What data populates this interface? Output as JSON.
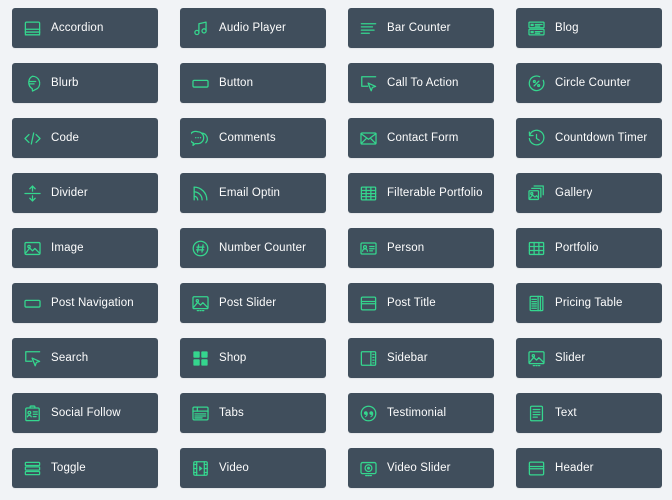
{
  "theme": {
    "background": "#f1f3f6",
    "card_background": "#404e5c",
    "icon_color": "#35d68e",
    "label_color": "#fdfdfd"
  },
  "grid": {
    "columns": 4,
    "rows": 9,
    "modules": [
      {
        "label": "Accordion",
        "icon": "accordion-icon"
      },
      {
        "label": "Audio Player",
        "icon": "music-note-icon"
      },
      {
        "label": "Bar Counter",
        "icon": "bar-lines-icon"
      },
      {
        "label": "Blog",
        "icon": "blog-list-icon"
      },
      {
        "label": "Blurb",
        "icon": "speech-bubble-icon"
      },
      {
        "label": "Button",
        "icon": "button-rectangle-icon"
      },
      {
        "label": "Call To Action",
        "icon": "cursor-click-icon"
      },
      {
        "label": "Circle Counter",
        "icon": "circle-percent-icon"
      },
      {
        "label": "Code",
        "icon": "code-brackets-icon"
      },
      {
        "label": "Comments",
        "icon": "comment-bubbles-icon"
      },
      {
        "label": "Contact Form",
        "icon": "envelope-icon"
      },
      {
        "label": "Countdown Timer",
        "icon": "clock-rewind-icon"
      },
      {
        "label": "Divider",
        "icon": "divider-arrows-icon"
      },
      {
        "label": "Email Optin",
        "icon": "signal-waves-icon"
      },
      {
        "label": "Filterable Portfolio",
        "icon": "grid-table-icon"
      },
      {
        "label": "Gallery",
        "icon": "photo-stack-icon"
      },
      {
        "label": "Image",
        "icon": "picture-icon"
      },
      {
        "label": "Number Counter",
        "icon": "hash-circle-icon"
      },
      {
        "label": "Person",
        "icon": "id-card-icon"
      },
      {
        "label": "Portfolio",
        "icon": "grid-cells-icon"
      },
      {
        "label": "Post Navigation",
        "icon": "button-rectangle-icon"
      },
      {
        "label": "Post Slider",
        "icon": "image-slider-icon"
      },
      {
        "label": "Post Title",
        "icon": "window-header-icon"
      },
      {
        "label": "Pricing Table",
        "icon": "pricing-columns-icon"
      },
      {
        "label": "Search",
        "icon": "cursor-click-icon"
      },
      {
        "label": "Shop",
        "icon": "four-squares-icon"
      },
      {
        "label": "Sidebar",
        "icon": "sidebar-panel-icon"
      },
      {
        "label": "Slider",
        "icon": "image-slider-icon"
      },
      {
        "label": "Social Follow",
        "icon": "social-card-icon"
      },
      {
        "label": "Tabs",
        "icon": "tabs-window-icon"
      },
      {
        "label": "Testimonial",
        "icon": "quote-circle-icon"
      },
      {
        "label": "Text",
        "icon": "text-document-icon"
      },
      {
        "label": "Toggle",
        "icon": "toggle-bars-icon"
      },
      {
        "label": "Video",
        "icon": "film-play-icon"
      },
      {
        "label": "Video Slider",
        "icon": "video-camera-icon"
      },
      {
        "label": "Header",
        "icon": "window-header-icon"
      }
    ]
  }
}
